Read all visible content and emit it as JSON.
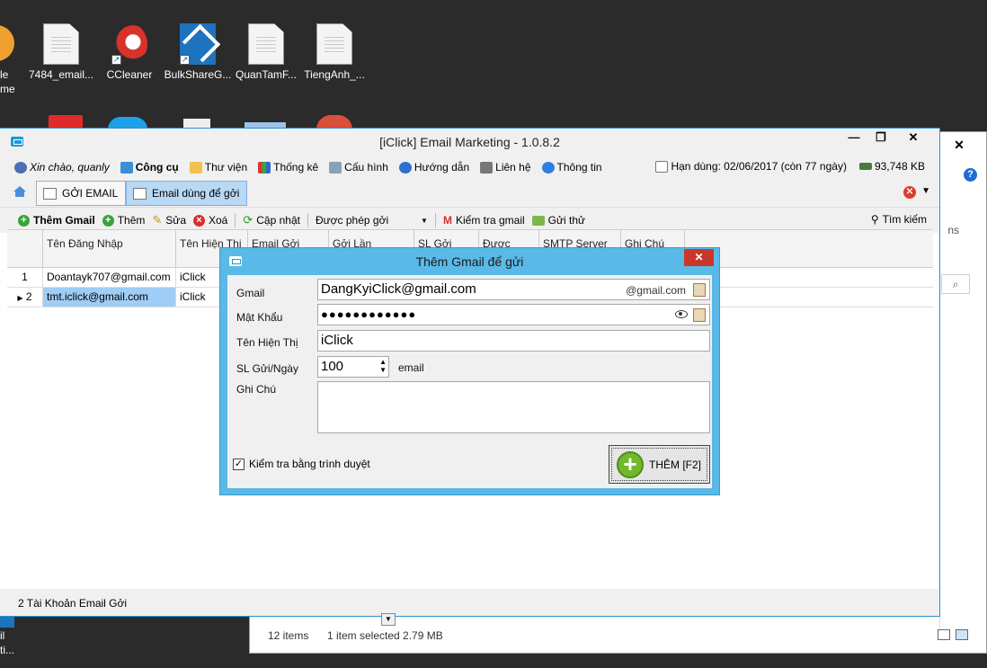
{
  "desktop": {
    "partial_icon_label_1": "le",
    "partial_icon_label_2": "me",
    "icons": [
      {
        "label": "7484_email...",
        "icon": "document-icon"
      },
      {
        "label": "CCleaner",
        "icon": "ccleaner-icon"
      },
      {
        "label": "BulkShareG...",
        "icon": "bulkshare-icon"
      },
      {
        "label": "QuanTamF...",
        "icon": "document-icon"
      },
      {
        "label": "TiengAnh_...",
        "icon": "document-icon"
      }
    ],
    "bottom_left_1": "il",
    "bottom_left_2": "ti..."
  },
  "explorer": {
    "close_label": "✕",
    "help_label": "?",
    "side_text": "ns",
    "status_items": "12 items",
    "status_selected": "1 item selected  2.79 MB"
  },
  "window": {
    "title": "[iClick] Email Marketing - 1.0.8.2",
    "minimize_label": "—",
    "maximize_label": "❐",
    "close_label": "✕",
    "menu": {
      "greeting": "Xin chào, quanly",
      "tools": "Công cụ",
      "library": "Thư viện",
      "stats": "Thống kê",
      "config": "Cấu hình",
      "guide": "Hướng dẫn",
      "contact": "Liên hệ",
      "info": "Thông tin",
      "expiry": "Hạn dùng: 02/06/2017 (còn 77 ngày)",
      "memory": "93,748 KB"
    },
    "tabs": [
      {
        "label": "GỞI EMAIL"
      },
      {
        "label": "Email dùng để gởi"
      }
    ],
    "toolbar": {
      "add_gmail": "Thêm Gmail",
      "add": "Thêm",
      "edit": "Sửa",
      "delete": "Xoá",
      "update": "Cập nhật",
      "filter_value": "Được phép gởi",
      "check_gmail": "Kiểm tra gmail",
      "send": "Gửi thử",
      "search": "Tìm kiếm"
    },
    "grid": {
      "headers": [
        "",
        "Tên Đăng Nhập",
        "Tên Hiện Thị",
        "Email Gởi",
        "Gởi Lần",
        "SL Gởi",
        "Được",
        "SMTP Server",
        "Ghi Chú"
      ],
      "rows": [
        {
          "no": "1",
          "username": "Doantayk707@gmail.com",
          "display": "iClick"
        },
        {
          "no": "2",
          "username": "tmt.iclick@gmail.com",
          "display": "iClick"
        }
      ]
    },
    "status": "2 Tài Khoản Email Gởi"
  },
  "dialog": {
    "title": "Thêm Gmail để gửi",
    "close_label": "✕",
    "gmail_label": "Gmail",
    "gmail_value": "DangKyiClick@gmail.com",
    "gmail_suffix": "@gmail.com",
    "password_label": "Mật Khẩu",
    "password_value": "●●●●●●●●●●●●",
    "display_label": "Tên Hiện Thị",
    "display_value": "iClick",
    "per_day_label": "SL Gửi/Ngày",
    "per_day_value": "100",
    "per_day_unit": "email",
    "notes_label": "Ghi Chú",
    "notes_value": "",
    "browser_check_label": "Kiểm tra bằng trình duyệt",
    "browser_check_checked": true,
    "add_button": "THÊM [F2]"
  }
}
